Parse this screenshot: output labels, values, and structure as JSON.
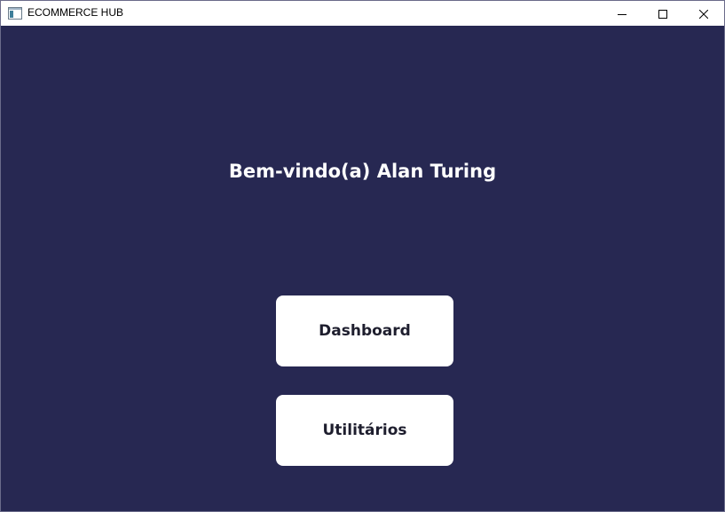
{
  "window": {
    "title": "ECOMMERCE HUB",
    "controls": {
      "minimize_icon": "minimize-icon",
      "maximize_icon": "maximize-icon",
      "close_icon": "close-icon"
    }
  },
  "main": {
    "welcome_text": "Bem-vindo(a) Alan Turing",
    "buttons": [
      {
        "label": "Dashboard"
      },
      {
        "label": "Utilitários"
      }
    ]
  },
  "colors": {
    "background": "#272852",
    "button_bg": "#ffffff",
    "button_text": "#1e1e2e",
    "welcome_text": "#ffffff"
  }
}
